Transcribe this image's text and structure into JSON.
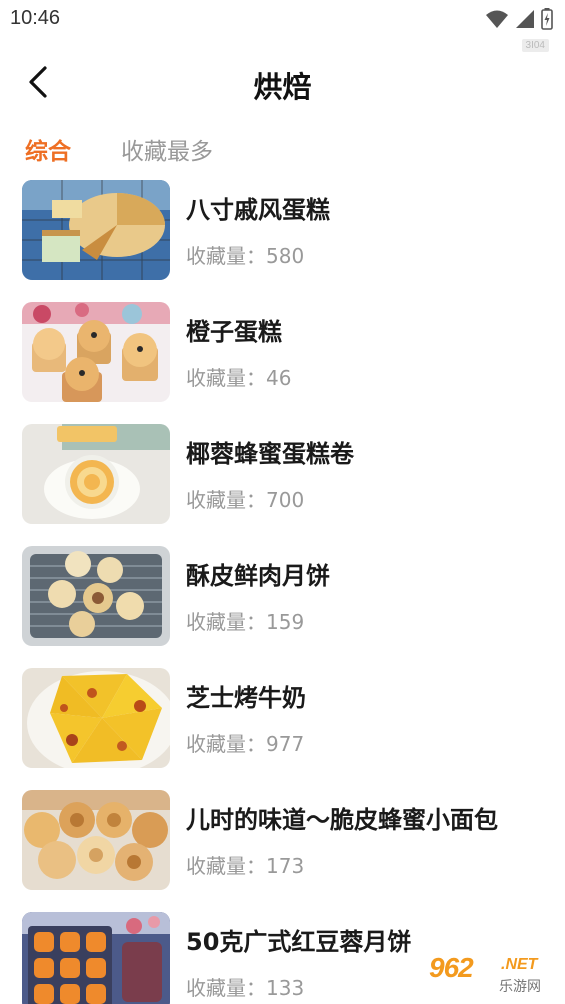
{
  "status_bar": {
    "time": "10:46",
    "indicator": "3I04"
  },
  "header": {
    "title": "烘焙",
    "back_icon": "chevron-left-icon"
  },
  "tabs": [
    {
      "label": "综合",
      "active": true
    },
    {
      "label": "收藏最多",
      "active": false
    }
  ],
  "recipes": [
    {
      "title": "八寸戚风蛋糕",
      "meta": "收藏量：580"
    },
    {
      "title": "橙子蛋糕",
      "meta": "收藏量：46"
    },
    {
      "title": "椰蓉蜂蜜蛋糕卷",
      "meta": "收藏量：700"
    },
    {
      "title": "酥皮鲜肉月饼",
      "meta": "收藏量：159"
    },
    {
      "title": "芝士烤牛奶",
      "meta": "收藏量：977"
    },
    {
      "title": "儿时的味道～脆皮蜂蜜小面包",
      "meta": "收藏量：173"
    },
    {
      "title": "50克广式红豆蓉月饼",
      "meta": "收藏量：133"
    }
  ],
  "watermark": {
    "logo": "962",
    "suffix": ".NET",
    "site": "乐游网"
  },
  "colors": {
    "accent": "#ee6f24",
    "muted": "#999999",
    "title": "#1a1a1a"
  }
}
